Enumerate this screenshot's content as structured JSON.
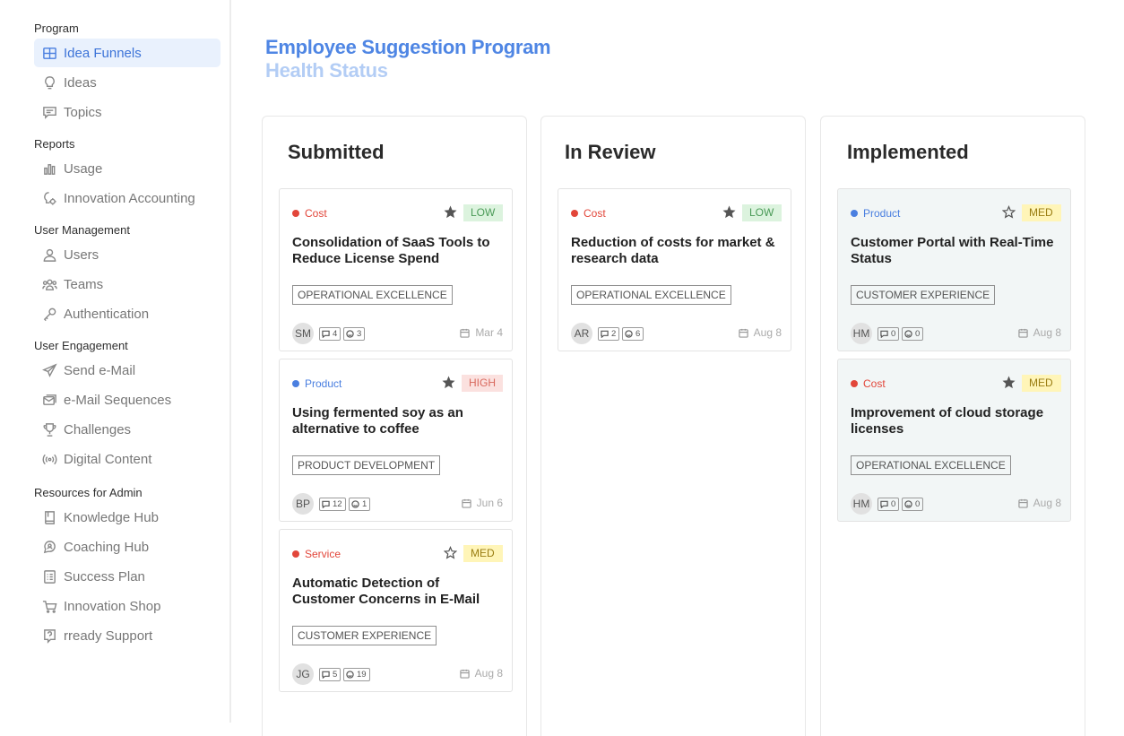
{
  "sidebar": {
    "sections": [
      {
        "title": "Program",
        "items": [
          {
            "label": "Idea Funnels",
            "icon": "grid-icon",
            "active": true
          },
          {
            "label": "Ideas",
            "icon": "lightbulb-icon"
          },
          {
            "label": "Topics",
            "icon": "message-square-icon"
          }
        ]
      },
      {
        "title": "Reports",
        "items": [
          {
            "label": "Usage",
            "icon": "bar-chart-icon"
          },
          {
            "label": "Innovation Accounting",
            "icon": "lightbulb-gear-icon"
          }
        ]
      },
      {
        "title": "User Management",
        "items": [
          {
            "label": "Users",
            "icon": "user-icon"
          },
          {
            "label": "Teams",
            "icon": "users-icon"
          },
          {
            "label": "Authentication",
            "icon": "key-icon"
          }
        ]
      },
      {
        "title": "User Engagement",
        "items": [
          {
            "label": "Send e-Mail",
            "icon": "paper-plane-icon"
          },
          {
            "label": "e-Mail Sequences",
            "icon": "mail-sequence-icon"
          },
          {
            "label": "Challenges",
            "icon": "trophy-icon"
          },
          {
            "label": "Digital Content",
            "icon": "broadcast-icon"
          }
        ]
      },
      {
        "title": "Resources for Admin",
        "items": [
          {
            "label": "Knowledge Hub",
            "icon": "book-icon"
          },
          {
            "label": "Coaching Hub",
            "icon": "coaching-icon"
          },
          {
            "label": "Success Plan",
            "icon": "checklist-icon"
          },
          {
            "label": "Innovation Shop",
            "icon": "cart-icon"
          },
          {
            "label": "rready Support",
            "icon": "help-icon"
          }
        ]
      }
    ]
  },
  "header": {
    "title": "Employee Suggestion Program",
    "subtitle": "Health Status"
  },
  "colors": {
    "accent": "#4f86e4",
    "cost": "#e2463a",
    "product": "#4a7fe0",
    "service": "#e2463a",
    "low_bg": "#dcf3de",
    "low_fg": "#4a9a57",
    "high_bg": "#fbe1df",
    "high_fg": "#d9695e",
    "med_bg": "#fff5b8",
    "med_fg": "#9a7d12"
  },
  "columns": [
    {
      "title": "Submitted",
      "cards": [
        {
          "category": "Cost",
          "priority": "LOW",
          "starred": true,
          "title": "Consolidation of SaaS Tools to Reduce License Spend",
          "tag": "OPERATIONAL EXCELLENCE",
          "avatar": "SM",
          "comments": "4",
          "likes": "3",
          "date": "Mar 4"
        },
        {
          "category": "Product",
          "priority": "HIGH",
          "starred": true,
          "title": "Using fermented soy as an alternative to coffee",
          "tag": "PRODUCT DEVELOPMENT",
          "avatar": "BP",
          "comments": "12",
          "likes": "1",
          "date": "Jun 6"
        },
        {
          "category": "Service",
          "priority": "MED",
          "starred": false,
          "title": "Automatic Detection of Customer Concerns in E-Mail",
          "tag": "CUSTOMER EXPERIENCE",
          "avatar": "JG",
          "comments": "5",
          "likes": "19",
          "date": "Aug 8"
        }
      ]
    },
    {
      "title": "In Review",
      "cards": [
        {
          "category": "Cost",
          "priority": "LOW",
          "starred": true,
          "title": "Reduction of costs for market & research data",
          "tag": "OPERATIONAL EXCELLENCE",
          "avatar": "AR",
          "comments": "2",
          "likes": "6",
          "date": "Aug 8"
        }
      ]
    },
    {
      "title": "Implemented",
      "cards": [
        {
          "category": "Product",
          "priority": "MED",
          "starred": false,
          "title": "Customer Portal with Real-Time Status",
          "tag": "CUSTOMER EXPERIENCE",
          "avatar": "HM",
          "comments": "0",
          "likes": "0",
          "date": "Aug 8"
        },
        {
          "category": "Cost",
          "priority": "MED",
          "starred": true,
          "title": "Improvement of cloud storage licenses",
          "tag": "OPERATIONAL EXCELLENCE",
          "avatar": "HM",
          "comments": "0",
          "likes": "0",
          "date": "Aug 8"
        }
      ]
    }
  ]
}
